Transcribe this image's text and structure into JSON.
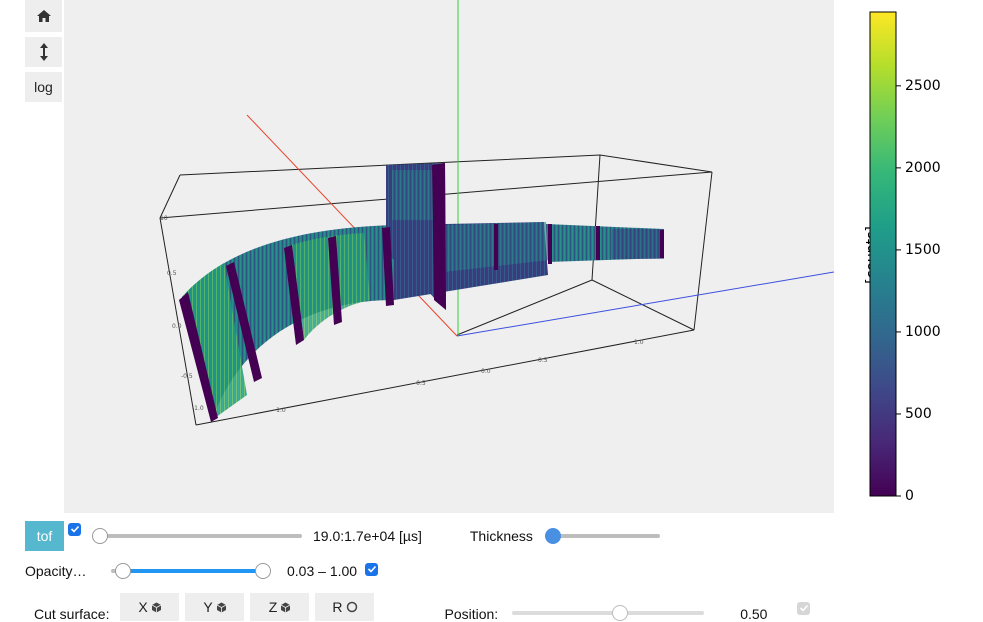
{
  "toolbar": {
    "home_icon": "home-icon",
    "vertical_icon": "vertical-arrows-icon",
    "log_label": "log"
  },
  "colorbar": {
    "label": "[counts]",
    "ticks": [
      {
        "value": 0,
        "label": "0"
      },
      {
        "value": 500,
        "label": "500"
      },
      {
        "value": 1000,
        "label": "1000"
      },
      {
        "value": 1500,
        "label": "1500"
      },
      {
        "value": 2000,
        "label": "2000"
      },
      {
        "value": 2500,
        "label": "2500"
      }
    ],
    "max": 2950,
    "colormap": [
      "#440154",
      "#482878",
      "#3e4989",
      "#31688e",
      "#26828e",
      "#1f9e89",
      "#35b779",
      "#6ece58",
      "#b5de2b",
      "#fde725"
    ]
  },
  "controls": {
    "tof_label": "tof",
    "tof_enabled": true,
    "tof_range_text": "19.0:1.7e+04 [µs]",
    "thickness_label": "Thickness",
    "opacity_label": "Opacity…",
    "opacity_range_text": "0.03 – 1.00",
    "opacity_low": 0.03,
    "opacity_high": 1.0,
    "opacity_enabled": true,
    "cut_surface_label": "Cut surface:",
    "cut_buttons": [
      "X",
      "Y",
      "Z",
      "R"
    ],
    "position_label": "Position:",
    "position_value": "0.50",
    "position_enabled": true
  },
  "axis_colors": {
    "x": "#e8452c",
    "y": "#34d13a",
    "z": "#3b4fe0"
  }
}
